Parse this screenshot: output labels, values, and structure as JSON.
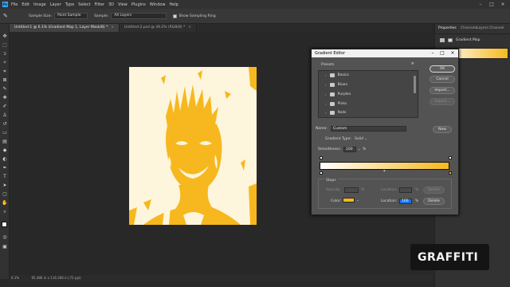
{
  "menubar": {
    "logo": "Ps",
    "items": [
      "File",
      "Edit",
      "Image",
      "Layer",
      "Type",
      "Select",
      "Filter",
      "3D",
      "View",
      "Plugins",
      "Window",
      "Help"
    ]
  },
  "options": {
    "sample_size_label": "Sample Size:",
    "sample_size_value": "Point Sample",
    "sample_label": "Sample:",
    "sample_value": "All Layers",
    "show_ring_label": "Show Sampling Ring"
  },
  "tabs": [
    {
      "label": "Untitled-1 @ 6.1% (Gradient Map 1, Layer Mask/8) *",
      "active": true
    },
    {
      "label": "Untitled-2.psd @ 39.2% (RGB/8) *",
      "active": false
    }
  ],
  "status": "6.1%",
  "status_info": "95.486 in x 116.306 in (72 ppi)",
  "right_panel": {
    "tabs": [
      "Properties",
      "Channels",
      "Layers",
      "Channel"
    ],
    "gradient_map_label": "Gradient Map"
  },
  "dialog": {
    "title": "Gradient Editor",
    "presets_label": "Presets",
    "preset_folders": [
      "Basics",
      "Blues",
      "Purples",
      "Pinks",
      "Reds"
    ],
    "ok": "OK",
    "cancel": "Cancel",
    "import": "Import...",
    "export": "Export...",
    "name_label": "Name:",
    "name_value": "Custom",
    "new": "New",
    "gradient_type_label": "Gradient Type:",
    "gradient_type_value": "Solid",
    "smoothness_label": "Smoothness:",
    "smoothness_value": "100",
    "smoothness_unit": "%",
    "stops_label": "Stops",
    "opacity_label": "Opacity:",
    "opacity_unit": "%",
    "location_label_top": "Location:",
    "location_unit_top": "%",
    "delete_top": "Delete",
    "color_label": "Color:",
    "location_label": "Location:",
    "location_value": "100",
    "location_unit": "%",
    "delete": "Delete",
    "gradient_start_color": "#ffffff",
    "gradient_end_color": "#f6b81e"
  },
  "colors": {
    "accent": "#f6b81e",
    "canvas_bg": "#fdf5dc"
  },
  "watermark": {
    "text": "GRAFFITI"
  }
}
